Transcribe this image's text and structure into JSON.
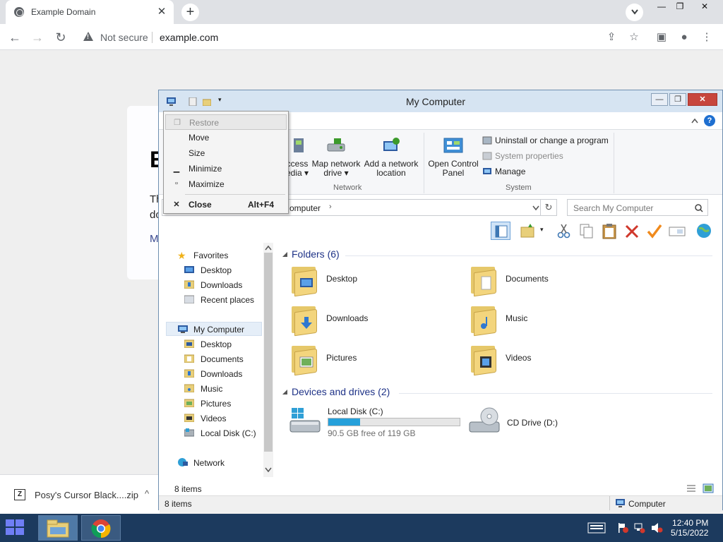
{
  "browser": {
    "tab_title": "Example Domain",
    "tab_close": "✕",
    "new_tab": "+",
    "security_label": "Not secure",
    "url": "example.com",
    "win_min": "—",
    "win_restore": "❐",
    "win_close": "✕"
  },
  "webpage": {
    "heading": "E",
    "para_line1": "Th",
    "para_line2": "do",
    "more_link": "M"
  },
  "download": {
    "filename": "Posy's Cursor Black....zip",
    "chevron": "^"
  },
  "explorer": {
    "title": "My Computer",
    "ribbon": {
      "help": "?",
      "items": {
        "access_media_l1": "ccess",
        "access_media_l2": "edia",
        "map_network_drive_l1": "Map network",
        "map_network_drive_l2": "drive",
        "add_network_location_l1": "Add a network",
        "add_network_location_l2": "location",
        "open_control_panel_l1": "Open Control",
        "open_control_panel_l2": "Panel",
        "uninstall": "Uninstall or change a program",
        "system_properties": "System properties",
        "manage": "Manage"
      },
      "groups": {
        "network": "Network",
        "system": "System"
      }
    },
    "address": {
      "path": "omputer",
      "chevron": "›"
    },
    "search_placeholder": "Search My Computer",
    "nav_pane": {
      "favorites": "Favorites",
      "fav_items": [
        "Desktop",
        "Downloads",
        "Recent places"
      ],
      "my_computer": "My Computer",
      "computer_items": [
        "Desktop",
        "Documents",
        "Downloads",
        "Music",
        "Pictures",
        "Videos",
        "Local Disk (C:)"
      ],
      "network": "Network"
    },
    "folders_header": "Folders (6)",
    "folders": [
      "Desktop",
      "Documents",
      "Downloads",
      "Music",
      "Pictures",
      "Videos"
    ],
    "drives_header": "Devices and drives (2)",
    "drives": [
      {
        "name": "Local Disk (C:)",
        "free": "90.5 GB free of 119 GB",
        "used_fraction": 0.24
      },
      {
        "name": "CD Drive (D:)"
      }
    ],
    "details_count": "8 items",
    "status_count": "8 items",
    "status_location": "Computer"
  },
  "system_menu": {
    "restore": "Restore",
    "move": "Move",
    "size": "Size",
    "minimize": "Minimize",
    "maximize": "Maximize",
    "close": "Close",
    "close_accel": "Alt+F4"
  },
  "taskbar": {
    "time": "12:40 PM",
    "date": "5/15/2022"
  },
  "colors": {
    "accent": "#26a0da",
    "section_heading": "#1e3287",
    "taskbar": "#1c3a5e",
    "close_button": "#c7463d"
  }
}
